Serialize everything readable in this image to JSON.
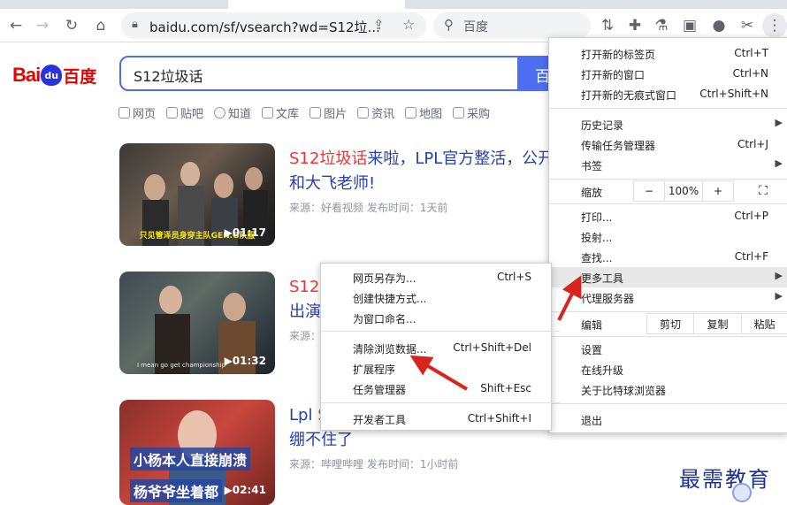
{
  "browser": {
    "url": "baidu.com/sf/vsearch?wd=S12垃...",
    "side_search": "百度"
  },
  "baidu": {
    "logo_bai": "Bai",
    "logo_du": "du",
    "logo_cn": "百度",
    "query": "S12垃圾话",
    "search_button": "百",
    "nav": [
      "网页",
      "贴吧",
      "知道",
      "文库",
      "图片",
      "资讯",
      "地图",
      "采购"
    ]
  },
  "results": [
    {
      "title_hl": "S12垃圾话",
      "title_rest": "来啦，LPL官方整活，公开",
      "title_line2": "和大飞老师!",
      "source": "来源：好看视频   发布时间：1天前",
      "duration": "01:17",
      "caption": "只见管泽员身穿主队GEN.G队服"
    },
    {
      "title_hl": "S12:",
      "title_rest": "",
      "title_line2": "出演",
      "source": "来源：",
      "duration": "01:32",
      "caption": "I mean go get championship"
    },
    {
      "title_hl": "Lpl",
      "title_rest": " S",
      "title_line2": "绷不住了",
      "source": "来源：哔哩哔哩   发布时间：1小时前",
      "duration": "02:41",
      "caption1": "小杨本人直接崩溃",
      "caption2": "杨爷爷坐着都"
    }
  ],
  "chrome_menu": {
    "new_tab": "打开新的标签页",
    "new_tab_sc": "Ctrl+T",
    "new_window": "打开新的窗口",
    "new_window_sc": "Ctrl+N",
    "incognito": "打开新的无痕式窗口",
    "incognito_sc": "Ctrl+Shift+N",
    "history": "历史记录",
    "task_mgr": "传输任务管理器",
    "task_mgr_sc": "Ctrl+J",
    "bookmarks": "书签",
    "zoom": "缩放",
    "zoom_minus": "−",
    "zoom_level": "100%",
    "zoom_plus": "+",
    "fullscreen": "⛶",
    "print": "打印...",
    "print_sc": "Ctrl+P",
    "cast": "投射...",
    "find": "查找...",
    "find_sc": "Ctrl+F",
    "more_tools": "更多工具",
    "proxy": "代理服务器",
    "edit": "编辑",
    "cut": "剪切",
    "copy": "复制",
    "paste": "粘贴",
    "settings": "设置",
    "update": "在线升级",
    "about": "关于比特球浏览器",
    "exit": "退出"
  },
  "submenu": {
    "save_as": "网页另存为...",
    "save_as_sc": "Ctrl+S",
    "shortcut": "创建快捷方式...",
    "name_window": "为窗口命名...",
    "clear_data": "清除浏览数据...",
    "clear_data_sc": "Ctrl+Shift+Del",
    "extensions": "扩展程序",
    "task_manager": "任务管理器",
    "task_manager_sc": "Shift+Esc",
    "devtools": "开发者工具",
    "devtools_sc": "Ctrl+Shift+I"
  },
  "watermark": "最需教育"
}
